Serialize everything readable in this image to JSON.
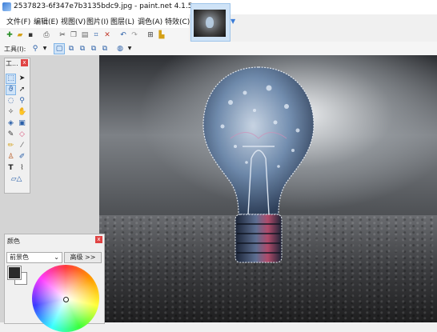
{
  "window": {
    "title": "2537823-6f347e7b3135bdc9.jpg - paint.net 4.1.5"
  },
  "menu": [
    {
      "label": "文件(F)"
    },
    {
      "label": "编辑(E)"
    },
    {
      "label": "视图(V)"
    },
    {
      "label": "图片(I)"
    },
    {
      "label": "图层(L)"
    },
    {
      "label": "调色(A)"
    },
    {
      "label": "特效(C)"
    }
  ],
  "toolbar": {
    "tool_label": "工具(I):",
    "tool_icons": [
      "new-icon",
      "open-icon",
      "save-icon",
      "print-icon",
      "cut-icon",
      "copy-icon",
      "paste-icon",
      "crop-icon",
      "deselect-icon",
      "undo-icon",
      "redo-icon",
      "grid-icon",
      "ruler-icon"
    ]
  },
  "tools_window": {
    "title": "工...",
    "close": "x"
  },
  "colors_window": {
    "title": "颜色",
    "close": "x",
    "mode_select": "前景色",
    "more_button": "高级 >>",
    "primary_color": "#2a2a2a",
    "secondary_color": "#ffffff"
  },
  "colors": {
    "accent": "#3b7dd8",
    "close": "#e04343",
    "selection": "#cfe3f7"
  }
}
